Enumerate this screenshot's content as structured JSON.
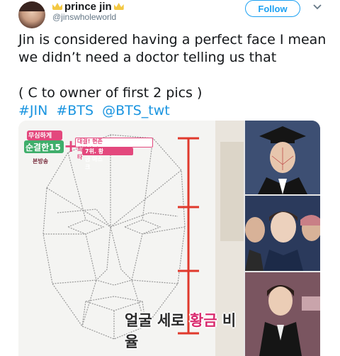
{
  "user": {
    "display_name": "prince jin",
    "handle": "@jinswholeworld"
  },
  "follow_label": "Follow",
  "tweet": {
    "line1": "Jin is considered having a perfect face I mean",
    "line2": "we didn’t need a doctor telling us that",
    "line3": "( C to owner of first 2 pics )",
    "hashtags": [
      "#JIN",
      "#BTS",
      "@BTS_twt"
    ]
  },
  "media": {
    "main": {
      "badge_title_1": "무심하게",
      "badge_title_2": "순결한15",
      "badge_sub_1": "대결! 현존 최강의 스타",
      "badge_sub_2": "7위. 황금 마스크",
      "badge_tag": "본방송",
      "caption_prefix": "얼굴 세로 ",
      "caption_highlight": "황금",
      "caption_suffix": " 비율"
    }
  },
  "colors": {
    "link": "#1b95e0",
    "follow": "#1da1f2",
    "ruler": "#e0392c",
    "badge_pink": "#e3487d",
    "badge_green": "#3fae6b"
  }
}
